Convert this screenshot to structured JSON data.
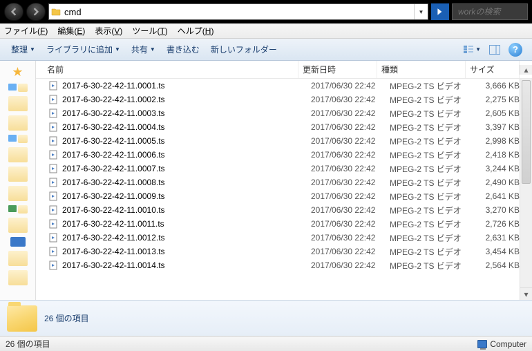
{
  "address": {
    "value": "cmd",
    "icon": "folder-icon"
  },
  "search": {
    "placeholder": "workの検索"
  },
  "menus": [
    {
      "label": "ファイル",
      "key": "F"
    },
    {
      "label": "編集",
      "key": "E"
    },
    {
      "label": "表示",
      "key": "V"
    },
    {
      "label": "ツール",
      "key": "T"
    },
    {
      "label": "ヘルプ",
      "key": "H"
    }
  ],
  "toolbar": {
    "organize": "整理",
    "add_library": "ライブラリに追加",
    "share": "共有",
    "burn": "書き込む",
    "new_folder": "新しいフォルダー"
  },
  "columns": {
    "name": "名前",
    "date": "更新日時",
    "type": "種類",
    "size": "サイズ"
  },
  "files": [
    {
      "name": "2017-6-30-22-42-11.0001.ts",
      "date": "2017/06/30 22:42",
      "type": "MPEG-2 TS ビデオ",
      "size": "3,666 KB"
    },
    {
      "name": "2017-6-30-22-42-11.0002.ts",
      "date": "2017/06/30 22:42",
      "type": "MPEG-2 TS ビデオ",
      "size": "2,275 KB"
    },
    {
      "name": "2017-6-30-22-42-11.0003.ts",
      "date": "2017/06/30 22:42",
      "type": "MPEG-2 TS ビデオ",
      "size": "2,605 KB"
    },
    {
      "name": "2017-6-30-22-42-11.0004.ts",
      "date": "2017/06/30 22:42",
      "type": "MPEG-2 TS ビデオ",
      "size": "3,397 KB"
    },
    {
      "name": "2017-6-30-22-42-11.0005.ts",
      "date": "2017/06/30 22:42",
      "type": "MPEG-2 TS ビデオ",
      "size": "2,998 KB"
    },
    {
      "name": "2017-6-30-22-42-11.0006.ts",
      "date": "2017/06/30 22:42",
      "type": "MPEG-2 TS ビデオ",
      "size": "2,418 KB"
    },
    {
      "name": "2017-6-30-22-42-11.0007.ts",
      "date": "2017/06/30 22:42",
      "type": "MPEG-2 TS ビデオ",
      "size": "3,244 KB"
    },
    {
      "name": "2017-6-30-22-42-11.0008.ts",
      "date": "2017/06/30 22:42",
      "type": "MPEG-2 TS ビデオ",
      "size": "2,490 KB"
    },
    {
      "name": "2017-6-30-22-42-11.0009.ts",
      "date": "2017/06/30 22:42",
      "type": "MPEG-2 TS ビデオ",
      "size": "2,641 KB"
    },
    {
      "name": "2017-6-30-22-42-11.0010.ts",
      "date": "2017/06/30 22:42",
      "type": "MPEG-2 TS ビデオ",
      "size": "3,270 KB"
    },
    {
      "name": "2017-6-30-22-42-11.0011.ts",
      "date": "2017/06/30 22:42",
      "type": "MPEG-2 TS ビデオ",
      "size": "2,726 KB"
    },
    {
      "name": "2017-6-30-22-42-11.0012.ts",
      "date": "2017/06/30 22:42",
      "type": "MPEG-2 TS ビデオ",
      "size": "2,631 KB"
    },
    {
      "name": "2017-6-30-22-42-11.0013.ts",
      "date": "2017/06/30 22:42",
      "type": "MPEG-2 TS ビデオ",
      "size": "3,454 KB"
    },
    {
      "name": "2017-6-30-22-42-11.0014.ts",
      "date": "2017/06/30 22:42",
      "type": "MPEG-2 TS ビデオ",
      "size": "2,564 KB"
    }
  ],
  "details": {
    "text": "26 個の項目"
  },
  "status": {
    "left": "26 個の項目",
    "right": "Computer"
  }
}
